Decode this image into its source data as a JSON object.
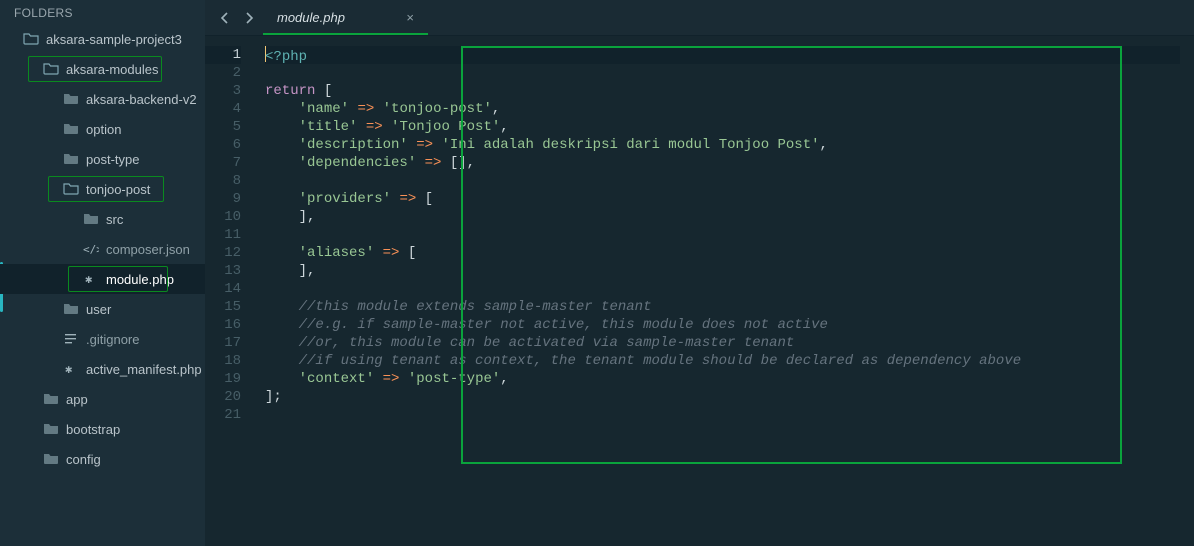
{
  "sidebar": {
    "header": "FOLDERS",
    "items": [
      {
        "label": "aksara-sample-project3",
        "depth": 0,
        "icon": "folder-open",
        "hl": false
      },
      {
        "label": "aksara-modules",
        "depth": 1,
        "icon": "folder-open",
        "hl": true,
        "hlLeft": 28,
        "hlWidth": 134
      },
      {
        "label": "aksara-backend-v2",
        "depth": 2,
        "icon": "folder-closed",
        "hl": false
      },
      {
        "label": "option",
        "depth": 2,
        "icon": "folder-closed",
        "hl": false
      },
      {
        "label": "post-type",
        "depth": 2,
        "icon": "folder-closed",
        "hl": false
      },
      {
        "label": "tonjoo-post",
        "depth": 2,
        "icon": "folder-open",
        "hl": true,
        "hlLeft": 48,
        "hlWidth": 116
      },
      {
        "label": "src",
        "depth": 3,
        "icon": "folder-closed",
        "hl": false
      },
      {
        "label": "composer.json",
        "depth": 3,
        "icon": "code-file",
        "hl": false,
        "muted": true
      },
      {
        "label": "module.php",
        "depth": 3,
        "icon": "file",
        "hl": true,
        "hlLeft": 68,
        "hlWidth": 100,
        "selected": true
      },
      {
        "label": "user",
        "depth": 2,
        "icon": "folder-closed",
        "hl": false
      },
      {
        "label": ".gitignore",
        "depth": 2,
        "icon": "lines-file",
        "hl": false,
        "muted": true
      },
      {
        "label": "active_manifest.php",
        "depth": 2,
        "icon": "file",
        "hl": false
      },
      {
        "label": "app",
        "depth": 1,
        "icon": "folder-closed",
        "hl": false
      },
      {
        "label": "bootstrap",
        "depth": 1,
        "icon": "folder-closed",
        "hl": false
      },
      {
        "label": "config",
        "depth": 1,
        "icon": "folder-closed",
        "hl": false
      }
    ]
  },
  "tab": {
    "title": "module.php"
  },
  "code": {
    "lines": [
      [
        {
          "t": "<?",
          "c": "tag"
        },
        {
          "t": "php",
          "c": "tag"
        }
      ],
      [],
      [
        {
          "t": "return",
          "c": "key"
        },
        {
          "t": " ["
        }
      ],
      [
        {
          "t": "    "
        },
        {
          "t": "'name'",
          "c": "str"
        },
        {
          "t": " "
        },
        {
          "t": "=>",
          "c": "arrow"
        },
        {
          "t": " "
        },
        {
          "t": "'tonjoo-post'",
          "c": "str"
        },
        {
          "t": ","
        }
      ],
      [
        {
          "t": "    "
        },
        {
          "t": "'title'",
          "c": "str"
        },
        {
          "t": " "
        },
        {
          "t": "=>",
          "c": "arrow"
        },
        {
          "t": " "
        },
        {
          "t": "'Tonjoo Post'",
          "c": "str"
        },
        {
          "t": ","
        }
      ],
      [
        {
          "t": "    "
        },
        {
          "t": "'description'",
          "c": "str"
        },
        {
          "t": " "
        },
        {
          "t": "=>",
          "c": "arrow"
        },
        {
          "t": " "
        },
        {
          "t": "'Ini adalah deskripsi dari modul Tonjoo Post'",
          "c": "str"
        },
        {
          "t": ","
        }
      ],
      [
        {
          "t": "    "
        },
        {
          "t": "'dependencies'",
          "c": "str"
        },
        {
          "t": " "
        },
        {
          "t": "=>",
          "c": "arrow"
        },
        {
          "t": " [],"
        }
      ],
      [],
      [
        {
          "t": "    "
        },
        {
          "t": "'providers'",
          "c": "str"
        },
        {
          "t": " "
        },
        {
          "t": "=>",
          "c": "arrow"
        },
        {
          "t": " ["
        }
      ],
      [
        {
          "t": "    ],"
        }
      ],
      [],
      [
        {
          "t": "    "
        },
        {
          "t": "'aliases'",
          "c": "str"
        },
        {
          "t": " "
        },
        {
          "t": "=>",
          "c": "arrow"
        },
        {
          "t": " ["
        }
      ],
      [
        {
          "t": "    ],"
        }
      ],
      [],
      [
        {
          "t": "    "
        },
        {
          "t": "//this module extends sample-master tenant",
          "c": "cmt"
        }
      ],
      [
        {
          "t": "    "
        },
        {
          "t": "//e.g. if sample-master not active, this module does not active",
          "c": "cmt"
        }
      ],
      [
        {
          "t": "    "
        },
        {
          "t": "//or, this module can be activated via sample-master tenant",
          "c": "cmt"
        }
      ],
      [
        {
          "t": "    "
        },
        {
          "t": "//if using tenant as context, the tenant module should be declared as dependency above",
          "c": "cmt"
        }
      ],
      [
        {
          "t": "    "
        },
        {
          "t": "'context'",
          "c": "str"
        },
        {
          "t": " "
        },
        {
          "t": "=>",
          "c": "arrow"
        },
        {
          "t": " "
        },
        {
          "t": "'post-type'",
          "c": "str"
        },
        {
          "t": ","
        }
      ],
      [
        {
          "t": "];"
        }
      ],
      []
    ],
    "activeLine": 1,
    "total": 21
  }
}
